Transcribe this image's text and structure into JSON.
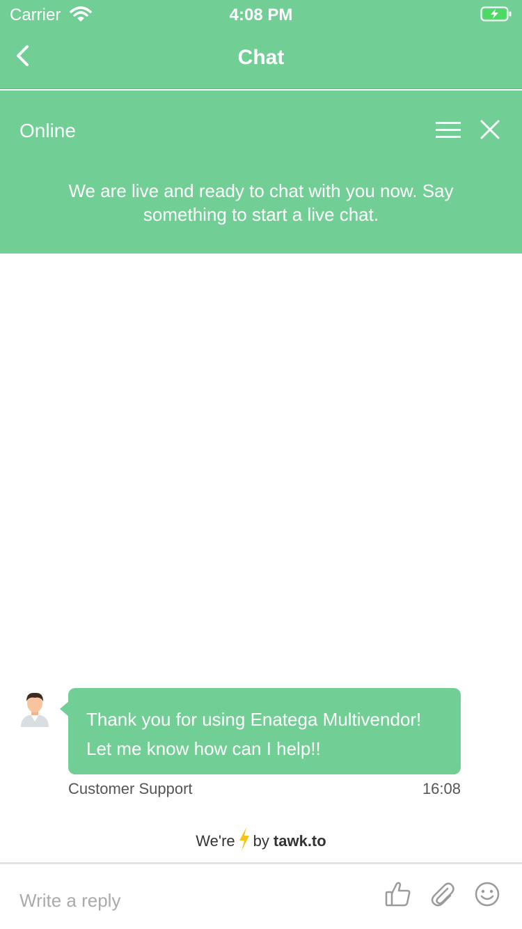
{
  "status_bar": {
    "carrier": "Carrier",
    "time": "4:08 PM"
  },
  "nav": {
    "title": "Chat"
  },
  "widget": {
    "status": "Online",
    "welcome_message": "We are live and ready to chat with you now. Say something to start a live chat."
  },
  "messages": [
    {
      "lines": [
        "Thank you for using Enatega Multivendor!",
        "Let me know how can I help!!"
      ],
      "sender": "Customer Support",
      "time": "16:08"
    }
  ],
  "branding": {
    "prefix": "We're",
    "suffix": "by",
    "brand": "tawk.to"
  },
  "composer": {
    "placeholder": "Write a reply"
  },
  "colors": {
    "accent": "#71cf95",
    "lightning": "#f5c518",
    "icon_gray": "#9a9a9a"
  },
  "icons": {
    "back": "chevron-left-icon",
    "wifi": "wifi-icon",
    "battery": "battery-charging-icon",
    "menu": "hamburger-menu-icon",
    "close": "close-icon",
    "avatar": "agent-avatar-icon",
    "lightning": "lightning-bolt-icon",
    "thumbs_up": "thumbs-up-icon",
    "attach": "paperclip-icon",
    "emoji": "smiley-icon"
  }
}
